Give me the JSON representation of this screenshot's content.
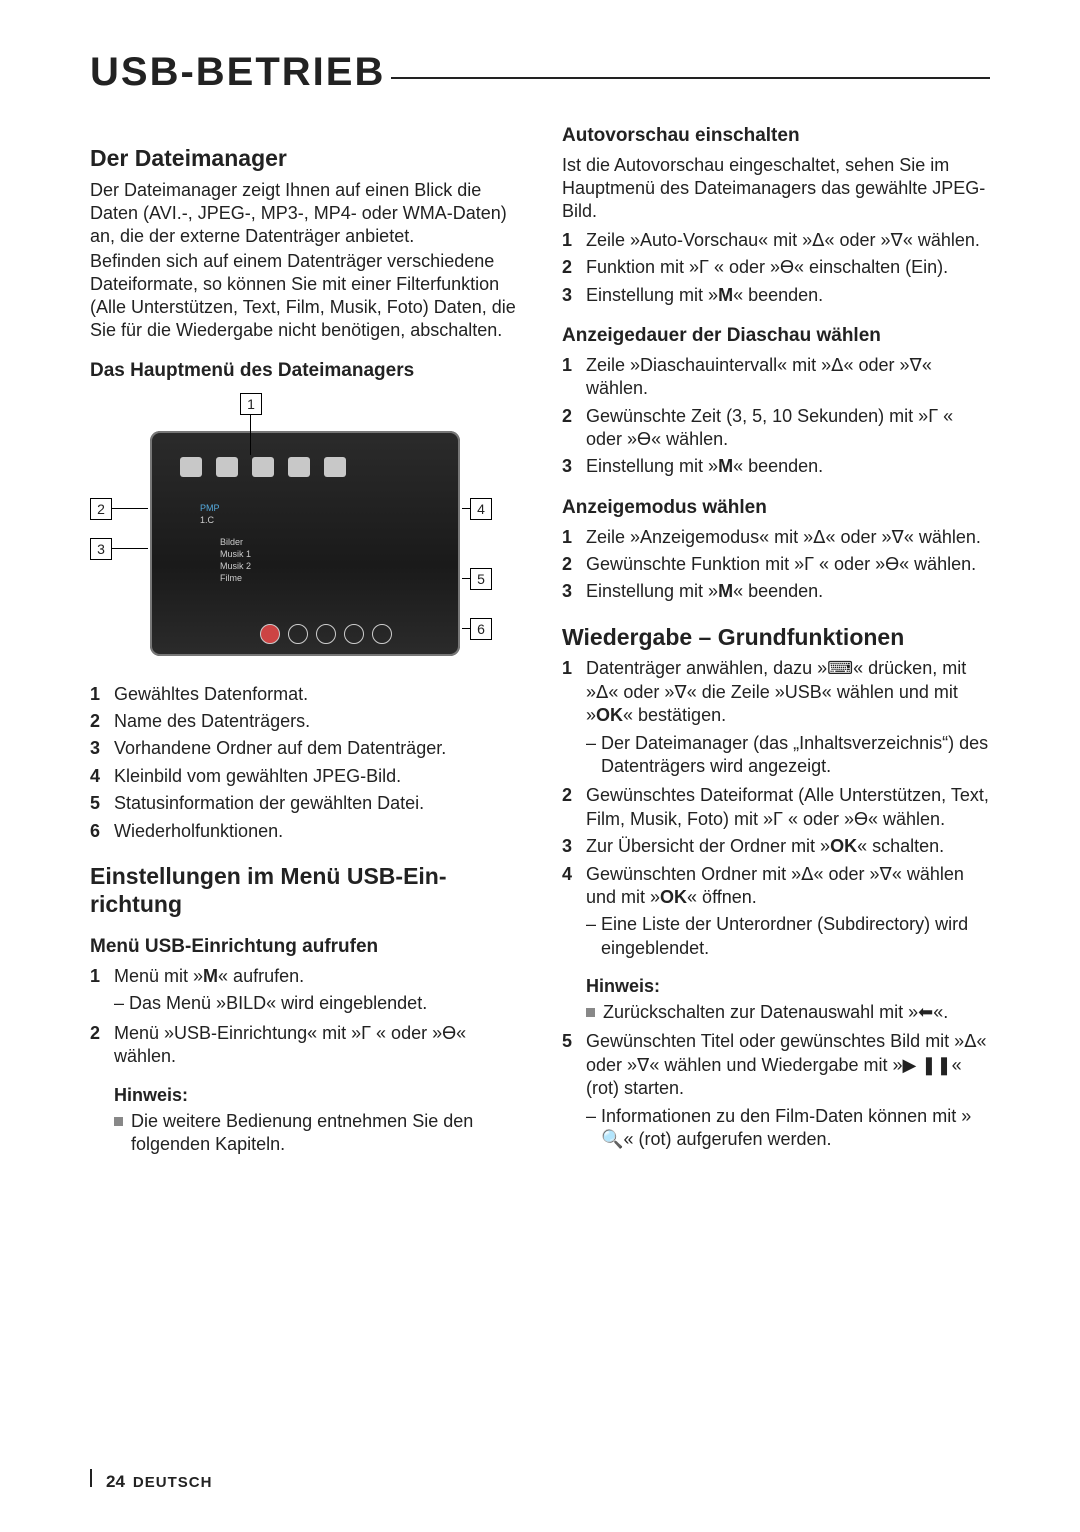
{
  "page": {
    "title": "USB-BETRIEB",
    "number": "24",
    "language": "DEUTSCH"
  },
  "left": {
    "h2_dateimanager": "Der Dateimanager",
    "dateimanager_p1": "Der Dateimanager zeigt Ihnen auf einen Blick die Daten (AVI.-, JPEG-, MP3-, MP4- oder WMA-Daten) an, die der externe Datenträger anbietet.",
    "dateimanager_p2": "Befinden sich auf einem Datenträger verschie­dene Dateiformate,  so können Sie mit einer Fil­terfunktion (Alle Unterstützen, Text, Film, Musik, Foto) Daten, die Sie für die Wiedergabe nicht benötigen, abschalten.",
    "h3_hauptmenu": "Das Hauptmenü des Dateimanagers",
    "diagram_labels": {
      "1": "1",
      "2": "2",
      "3": "3",
      "4": "4",
      "5": "5",
      "6": "6"
    },
    "diag_text": {
      "pmp": "PMP",
      "1c": "1.C",
      "bilder": "Bilder",
      "m1": "Musik 1",
      "m2": "Musik 2",
      "filme": "Filme"
    },
    "legend": [
      {
        "n": "1",
        "t": "Gewähltes Datenformat."
      },
      {
        "n": "2",
        "t": "Name des Datenträgers."
      },
      {
        "n": "3",
        "t": "Vorhandene Ordner auf dem Datenträger."
      },
      {
        "n": "4",
        "t": "Kleinbild vom gewählten JPEG-Bild."
      },
      {
        "n": "5",
        "t": "Statusinformation der gewählten Datei."
      },
      {
        "n": "6",
        "t": "Wiederholfunktionen."
      }
    ],
    "h2_einst": "Einstellungen im Menü USB-Ein­richtung",
    "h3_aufrufen": "Menü USB-Einrichtung aufrufen",
    "aufrufen_1a": "Menü mit »",
    "aufrufen_1b": "« aufrufen.",
    "aufrufen_1_dash": "Das Menü »BILD« wird eingeblendet.",
    "aufrufen_2a": "Menü »USB-Einrichtung« mit »",
    "aufrufen_2b": " « oder »",
    "aufrufen_2c": "« wählen.",
    "hinweis_label": "Hinweis:",
    "hinweis_bullet": "Die weitere Bedienung entnehmen Sie den folgenden Kapiteln."
  },
  "right": {
    "h3_autov": "Autovorschau einschalten",
    "autov_p": "Ist die Autovorschau eingeschaltet, sehen Sie im Hauptmenü des Dateimanagers das gewählte JPEG-Bild.",
    "autov_1a": "Zeile »Auto-Vorschau« mit »",
    "autov_1b": "« oder »",
    "autov_1c": "« wählen.",
    "autov_2a": "Funktion mit »",
    "autov_2b": " « oder »",
    "autov_2c": "« einschalten (Ein).",
    "autov_3a": "Einstellung mit »",
    "autov_3b": "« beenden.",
    "h3_dia": "Anzeigedauer der Diaschau wählen",
    "dia_1a": "Zeile »Diaschauintervall« mit »",
    "dia_1b": "« oder »",
    "dia_1c": "« wählen.",
    "dia_2a": "Gewünschte Zeit (3, 5, 10 Sekunden) mit »",
    "dia_2b": " « oder »",
    "dia_2c": "« wählen.",
    "dia_3a": "Einstellung mit »",
    "dia_3b": "« beenden.",
    "h3_mode": "Anzeigemodus wählen",
    "mode_1a": "Zeile »Anzeigemodus« mit »",
    "mode_1b": "« oder »",
    "mode_1c": "« wählen.",
    "mode_2a": "Gewünschte Funktion mit »",
    "mode_2b": " « oder »",
    "mode_2c": "« wäh­len.",
    "mode_3a": "Einstellung mit »",
    "mode_3b": "« beenden.",
    "h2_wg": "Wiedergabe – Grundfunktionen",
    "wg_1a": "Datenträger anwählen, dazu »",
    "wg_1b": "« drücken, mit »",
    "wg_1c": "« oder »",
    "wg_1d": "« die Zeile »USB« wählen und mit »",
    "wg_1e": "« bestätigen.",
    "wg_1_dash": "Der Dateimanager (das „Inhaltsverzeich­nis“) des Datenträgers wird angezeigt.",
    "wg_2a": "Gewünschtes Dateiformat (Alle Unterstützen, Text, Film, Musik, Foto) mit »",
    "wg_2b": " « oder »",
    "wg_2c": "« wählen.",
    "wg_3a": "Zur Übersicht der Ordner mit »",
    "wg_3b": "« schalten.",
    "wg_4a": "Gewünschten Ordner mit »",
    "wg_4b": "« oder »",
    "wg_4c": "« wählen und mit »",
    "wg_4d": "« öffnen.",
    "wg_4_dash": "Eine Liste der Unterordner (Subdirectory) wird eingeblendet.",
    "wg_hinweis_label": "Hinweis:",
    "wg_hinweis_bullet_a": "Zurückschalten zur Datenauswahl mit »",
    "wg_hinweis_bullet_b": "«.",
    "wg_5a": "Gewünschten Titel oder gewünschtes Bild mit »",
    "wg_5b": "« oder »",
    "wg_5c": "« wählen und Wiedergabe mit »",
    "wg_5d": "« (rot) starten.",
    "wg_5_dash_a": "Informationen zu den Film-Daten können mit »",
    "wg_5_dash_b": "« (rot) aufgerufen werden."
  },
  "glyph": {
    "up": "ᐃ",
    "down": "ᐁ",
    "left": "Γ",
    "right": "Ɵ",
    "M": "M",
    "OK": "OK",
    "tv": "⌨",
    "back": "⬅",
    "play": "▶",
    "pause": "❚❚",
    "search": "🔍"
  }
}
